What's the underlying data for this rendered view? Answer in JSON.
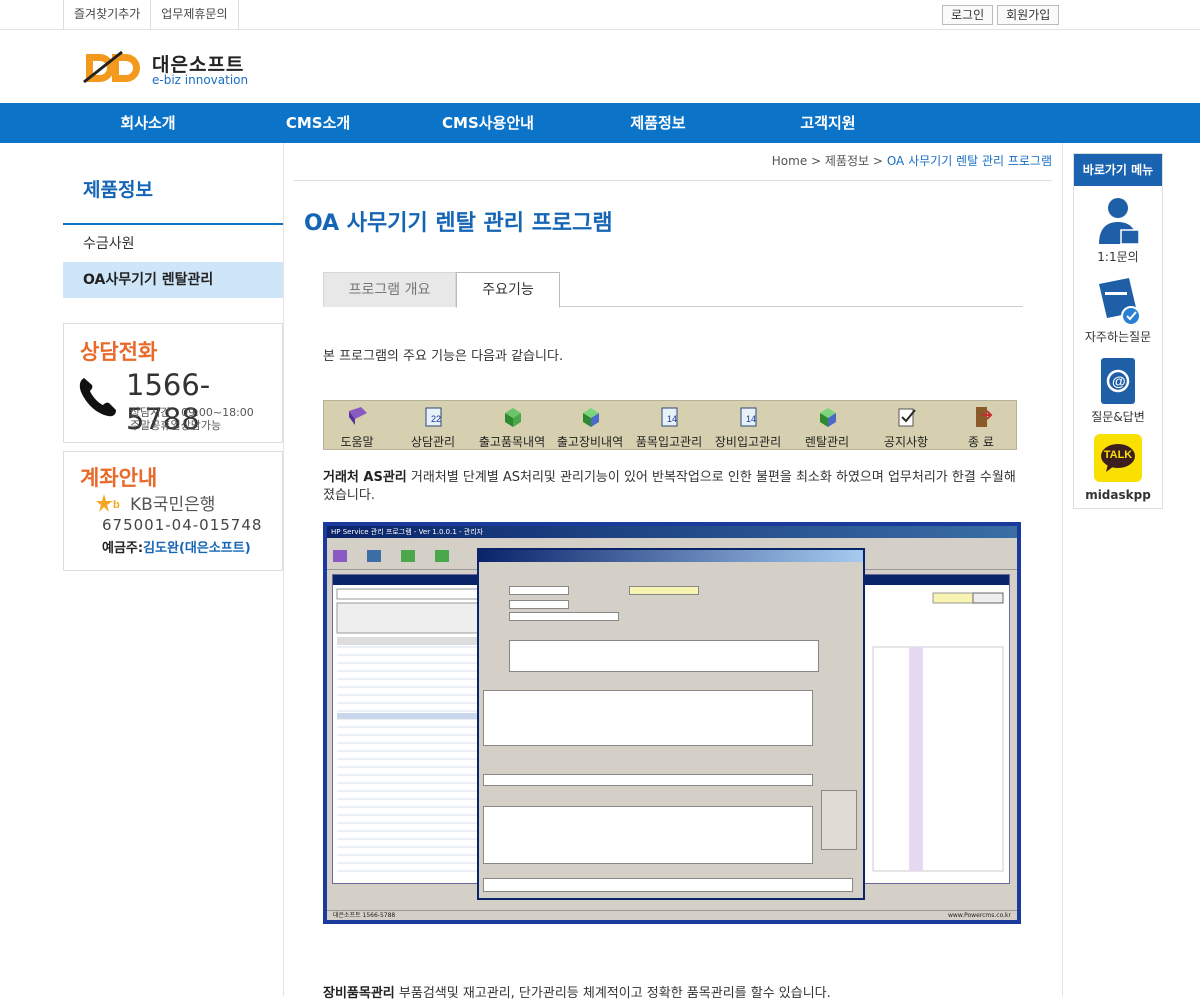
{
  "util": {
    "bookmark": "즐겨찾기추가",
    "partner": "업무제휴문의",
    "login": "로그인",
    "join": "회원가입"
  },
  "logo": {
    "name": "대은소프트",
    "sub": "e-biz innovation"
  },
  "gnb": [
    "회사소개",
    "CMS소개",
    "CMS사용안내",
    "제품정보",
    "고객지원"
  ],
  "side": {
    "title": "제품정보",
    "menu": [
      "수금사원",
      "OA사무기기 렌탈관리"
    ],
    "tel": {
      "title": "상담전화",
      "number": "1566-5788",
      "hours1": "상담시간 : 09:00~18:00",
      "hours2": "주말공휴일상담가능"
    },
    "account": {
      "title": "계좌안내",
      "bank": "KB국민은행",
      "number": "675001-04-015748",
      "owner_label": "예금주:",
      "owner": "김도완(대은소프트)"
    }
  },
  "breadcrumb": {
    "home": "Home",
    "sep": ">",
    "level1": "제품정보",
    "current": "OA 사무기기 렌탈 관리 프로그램"
  },
  "page_title": "OA 사무기기 렌탈 관리 프로그램",
  "tabs": [
    "프로그램 개요",
    "주요기능"
  ],
  "intro": "본 프로그램의 주요 기능은 다음과 같습니다.",
  "toolbar": [
    "도움말",
    "상담관리",
    "출고품목내역",
    "출고장비내역",
    "품목입고관리",
    "장비입고관리",
    "렌탈관리",
    "공지사항",
    "종 료"
  ],
  "feature1": {
    "title": "거래처 AS관리",
    "text": " 거래처별 단계별 AS처리및 관리기능이 있어 반복작업으로 인한 불편을 최소화 하였으며 업무처리가 한결 수월해 졌습니다."
  },
  "screenshot": {
    "window_title": "HP Service 관리 프로그램 - Ver 1.0.0.1 - 관리자",
    "status_left": "대은소프트 1566-5788",
    "status_right": "www.Powercms.co.kr"
  },
  "feature2": {
    "title": "장비품목관리",
    "text": " 부품검색및 재고관리, 단가관리등 체계적이고 정확한 품목관리를 할수 있습니다."
  },
  "quick": {
    "title": "바로가기 메뉴",
    "items": [
      "1:1문의",
      "자주하는질문",
      "질문&답변",
      "midaskpp"
    ],
    "kakao_badge": "TALK"
  }
}
